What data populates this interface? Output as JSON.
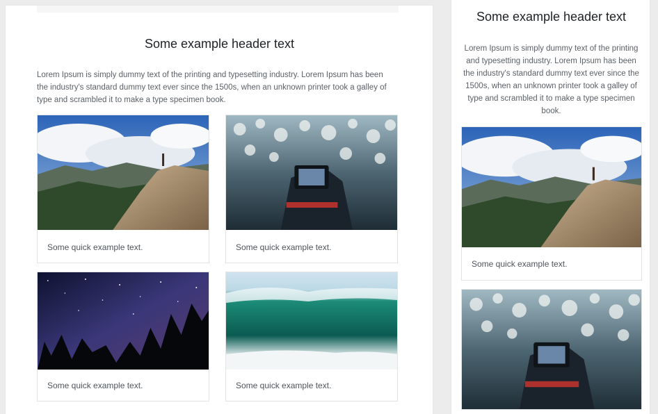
{
  "header": {
    "title": "Some example header text"
  },
  "intro": {
    "text": "Lorem Ipsum is simply dummy text of the printing and typesetting industry. Lorem Ipsum has been the industry's standard dummy text ever since the 1500s, when an unknown printer took a galley of type and scrambled it to make a type specimen book."
  },
  "cards": [
    {
      "text": "Some quick example text.",
      "image": "mountain-cliff-photo"
    },
    {
      "text": "Some quick example text.",
      "image": "phone-camera-bokeh-photo"
    },
    {
      "text": "Some quick example text.",
      "image": "starry-night-forest-photo"
    },
    {
      "text": "Some quick example text.",
      "image": "ocean-wave-photo"
    }
  ]
}
